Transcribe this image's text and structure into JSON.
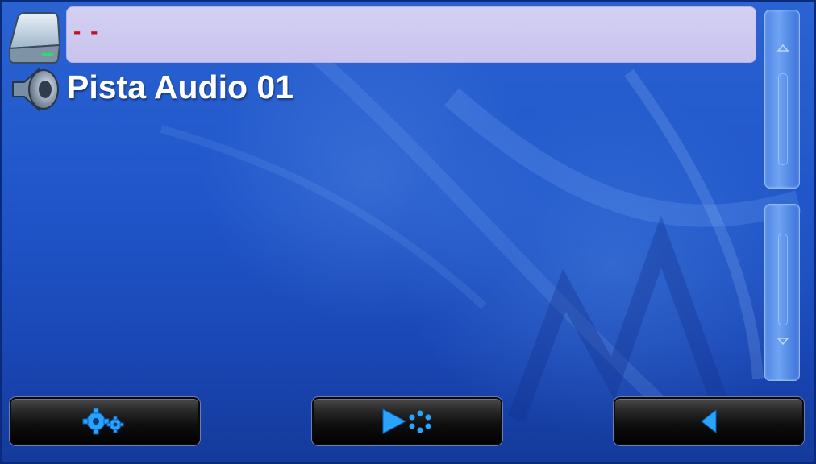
{
  "path_bar": {
    "text": "- -"
  },
  "file_list": {
    "items": [
      {
        "label": "Pista Audio 01",
        "icon": "speaker-icon"
      }
    ]
  },
  "scrollbar": {
    "up_icon": "chevron-up-icon",
    "down_icon": "chevron-down-icon"
  },
  "toolbar": {
    "buttons": [
      {
        "icon": "settings-gears-icon"
      },
      {
        "icon": "play-settings-icon"
      },
      {
        "icon": "back-arrow-icon"
      }
    ]
  },
  "colors": {
    "background": "#2158cc",
    "path_bar": "#cdc8f0",
    "path_text": "#c2102a",
    "accent_icon": "#29a0ff"
  }
}
